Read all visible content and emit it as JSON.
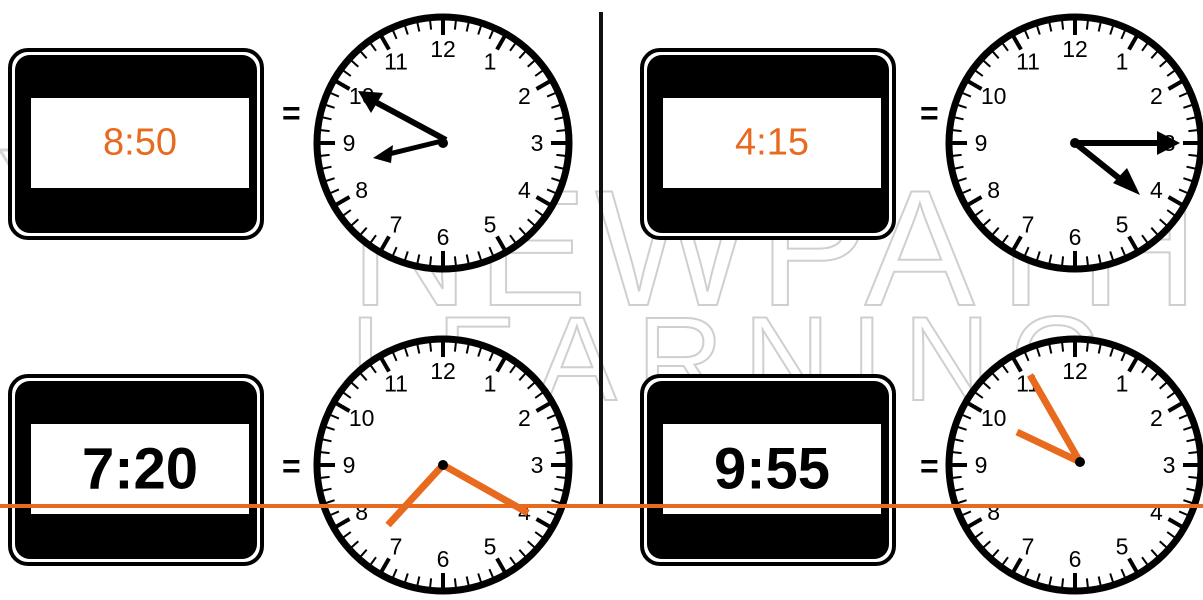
{
  "watermark": {
    "line1": "NEWPATH",
    "line2": "LEARNING"
  },
  "accent_color": "#e86a1e",
  "panels": [
    {
      "digital": "8:50",
      "equals": "=",
      "clock_hands": "drawn",
      "text_style": "orange"
    },
    {
      "digital": "4:15",
      "equals": "=",
      "clock_hands": "drawn",
      "text_style": "orange"
    },
    {
      "digital": "7:20",
      "equals": "=",
      "clock_hands": "student",
      "text_style": "bold"
    },
    {
      "digital": "9:55",
      "equals": "=",
      "clock_hands": "student",
      "text_style": "bold"
    }
  ],
  "clock_numbers": [
    "12",
    "1",
    "2",
    "3",
    "4",
    "5",
    "6",
    "7",
    "8",
    "9",
    "10",
    "11"
  ]
}
